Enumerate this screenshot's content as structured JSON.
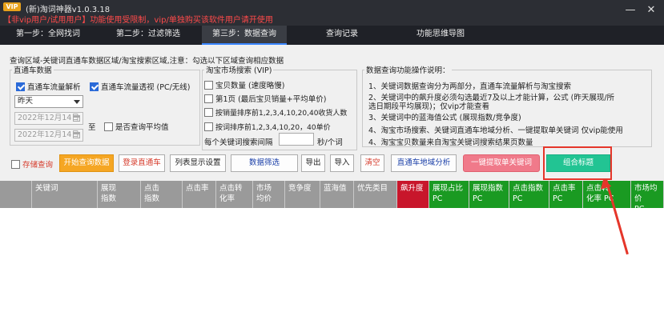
{
  "window": {
    "vip_badge": "VIP",
    "title": "(新)淘词神器v1.0.3.18",
    "notice": "【非vip用户/试用用户】功能使用受限制，vip/单独购买该软件用户请开使用",
    "min_icon": "—",
    "close_icon": "✕"
  },
  "tabs": [
    {
      "label": "第一步：全网找词"
    },
    {
      "label": "第二步：过滤筛选"
    },
    {
      "label": "第三步：数据查询"
    },
    {
      "label": "查询记录"
    },
    {
      "label": "功能思维导图"
    }
  ],
  "query_area": {
    "title": "查询区域-关键词直通车数据区域/淘宝搜索区域,注意：勾选以下区域查询相应数据",
    "zhitongche": {
      "legend": "直通车数据",
      "traffic_analysis": "直通车流量解析",
      "traffic_perspective": "直通车流量透视 (PC/无线)",
      "period": "昨天",
      "date_from": "2022年12月14日",
      "to": "至",
      "date_to": "2022年12月14日",
      "avg_label": "是否查询平均值"
    },
    "taobao": {
      "legend": "淘宝市场搜索 (VIP)",
      "item_count": "宝贝数量 (速度略慢)",
      "first_page": "第1页 (最后宝贝销量+平均单价)",
      "sales_rank": "按销量排序前1,2,3,4,10,20,40收货人数",
      "rank_price": "按词排序前1,2,3,4,10,20，40单价",
      "interval_label": "每个关键词搜索间隔",
      "interval_unit": "秒/个词"
    }
  },
  "info": {
    "legend": "数据查询功能操作说明：",
    "lines": [
      "1、关键词数据查询分为两部分，直通车流量解析与淘宝搜索",
      "2、关键词中的飙升度必须勾选最近7及以上才能计算，公式 (昨天展现/所",
      "选日期段平均展现)；仅vip才能查看",
      "3、关键词中的蓝海值公式 (展现指数/竞争度)",
      "4、淘宝市场搜索、关键词直通车地域分析、一键提取单关键词 仅vip能使用",
      "4、淘宝宝贝数量来自淘宝关键词搜索结果页数量"
    ]
  },
  "toolbar": {
    "save_query": "存储查询",
    "start": "开始查询数据",
    "login": "登录直通车",
    "list_settings": "列表显示设置",
    "filter": "数据筛选",
    "export": "导出",
    "import": "导入",
    "clear": "清空",
    "region": "直通车地域分析",
    "extract": "一键提取单关键词",
    "combine": "组合标题"
  },
  "columns": [
    {
      "a": "关键词",
      "b": ""
    },
    {
      "a": "展现",
      "b": "指数"
    },
    {
      "a": "点击",
      "b": "指数"
    },
    {
      "a": "点击率",
      "b": ""
    },
    {
      "a": "点击转",
      "b": "化率"
    },
    {
      "a": "市场",
      "b": "均价"
    },
    {
      "a": "竞争度",
      "b": ""
    },
    {
      "a": "蓝海值",
      "b": ""
    },
    {
      "a": "优先类目",
      "b": ""
    },
    {
      "a": "飙升度",
      "b": ""
    },
    {
      "a": "展现占比",
      "b": "PC"
    },
    {
      "a": "展现指数",
      "b": "PC"
    },
    {
      "a": "点击指数",
      "b": "PC"
    },
    {
      "a": "点击率",
      "b": "PC"
    },
    {
      "a": "点击转",
      "b": "化率 PC"
    },
    {
      "a": "市场均价",
      "b": "PC"
    }
  ]
}
